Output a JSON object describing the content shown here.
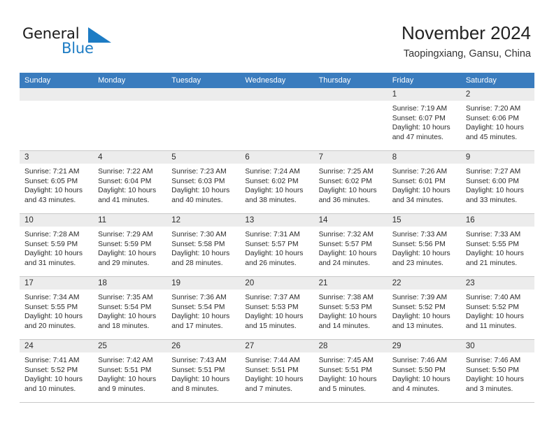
{
  "brand": {
    "name_top": "General",
    "name_bottom": "Blue",
    "mark_icon": "triangle-flag-icon",
    "accent_color": "#1d7cc4"
  },
  "header": {
    "title": "November 2024",
    "subtitle": "Taopingxiang, Gansu, China"
  },
  "calendar": {
    "header_bg": "#3a7cbe",
    "datebar_bg": "#ececec",
    "weekdays": [
      "Sunday",
      "Monday",
      "Tuesday",
      "Wednesday",
      "Thursday",
      "Friday",
      "Saturday"
    ],
    "weeks": [
      [
        {
          "day": "",
          "empty": true,
          "sunrise": "",
          "sunset": "",
          "daylight1": "",
          "daylight2": ""
        },
        {
          "day": "",
          "empty": true,
          "sunrise": "",
          "sunset": "",
          "daylight1": "",
          "daylight2": ""
        },
        {
          "day": "",
          "empty": true,
          "sunrise": "",
          "sunset": "",
          "daylight1": "",
          "daylight2": ""
        },
        {
          "day": "",
          "empty": true,
          "sunrise": "",
          "sunset": "",
          "daylight1": "",
          "daylight2": ""
        },
        {
          "day": "",
          "empty": true,
          "sunrise": "",
          "sunset": "",
          "daylight1": "",
          "daylight2": ""
        },
        {
          "day": "1",
          "empty": false,
          "sunrise": "Sunrise: 7:19 AM",
          "sunset": "Sunset: 6:07 PM",
          "daylight1": "Daylight: 10 hours",
          "daylight2": "and 47 minutes."
        },
        {
          "day": "2",
          "empty": false,
          "sunrise": "Sunrise: 7:20 AM",
          "sunset": "Sunset: 6:06 PM",
          "daylight1": "Daylight: 10 hours",
          "daylight2": "and 45 minutes."
        }
      ],
      [
        {
          "day": "3",
          "empty": false,
          "sunrise": "Sunrise: 7:21 AM",
          "sunset": "Sunset: 6:05 PM",
          "daylight1": "Daylight: 10 hours",
          "daylight2": "and 43 minutes."
        },
        {
          "day": "4",
          "empty": false,
          "sunrise": "Sunrise: 7:22 AM",
          "sunset": "Sunset: 6:04 PM",
          "daylight1": "Daylight: 10 hours",
          "daylight2": "and 41 minutes."
        },
        {
          "day": "5",
          "empty": false,
          "sunrise": "Sunrise: 7:23 AM",
          "sunset": "Sunset: 6:03 PM",
          "daylight1": "Daylight: 10 hours",
          "daylight2": "and 40 minutes."
        },
        {
          "day": "6",
          "empty": false,
          "sunrise": "Sunrise: 7:24 AM",
          "sunset": "Sunset: 6:02 PM",
          "daylight1": "Daylight: 10 hours",
          "daylight2": "and 38 minutes."
        },
        {
          "day": "7",
          "empty": false,
          "sunrise": "Sunrise: 7:25 AM",
          "sunset": "Sunset: 6:02 PM",
          "daylight1": "Daylight: 10 hours",
          "daylight2": "and 36 minutes."
        },
        {
          "day": "8",
          "empty": false,
          "sunrise": "Sunrise: 7:26 AM",
          "sunset": "Sunset: 6:01 PM",
          "daylight1": "Daylight: 10 hours",
          "daylight2": "and 34 minutes."
        },
        {
          "day": "9",
          "empty": false,
          "sunrise": "Sunrise: 7:27 AM",
          "sunset": "Sunset: 6:00 PM",
          "daylight1": "Daylight: 10 hours",
          "daylight2": "and 33 minutes."
        }
      ],
      [
        {
          "day": "10",
          "empty": false,
          "sunrise": "Sunrise: 7:28 AM",
          "sunset": "Sunset: 5:59 PM",
          "daylight1": "Daylight: 10 hours",
          "daylight2": "and 31 minutes."
        },
        {
          "day": "11",
          "empty": false,
          "sunrise": "Sunrise: 7:29 AM",
          "sunset": "Sunset: 5:59 PM",
          "daylight1": "Daylight: 10 hours",
          "daylight2": "and 29 minutes."
        },
        {
          "day": "12",
          "empty": false,
          "sunrise": "Sunrise: 7:30 AM",
          "sunset": "Sunset: 5:58 PM",
          "daylight1": "Daylight: 10 hours",
          "daylight2": "and 28 minutes."
        },
        {
          "day": "13",
          "empty": false,
          "sunrise": "Sunrise: 7:31 AM",
          "sunset": "Sunset: 5:57 PM",
          "daylight1": "Daylight: 10 hours",
          "daylight2": "and 26 minutes."
        },
        {
          "day": "14",
          "empty": false,
          "sunrise": "Sunrise: 7:32 AM",
          "sunset": "Sunset: 5:57 PM",
          "daylight1": "Daylight: 10 hours",
          "daylight2": "and 24 minutes."
        },
        {
          "day": "15",
          "empty": false,
          "sunrise": "Sunrise: 7:33 AM",
          "sunset": "Sunset: 5:56 PM",
          "daylight1": "Daylight: 10 hours",
          "daylight2": "and 23 minutes."
        },
        {
          "day": "16",
          "empty": false,
          "sunrise": "Sunrise: 7:33 AM",
          "sunset": "Sunset: 5:55 PM",
          "daylight1": "Daylight: 10 hours",
          "daylight2": "and 21 minutes."
        }
      ],
      [
        {
          "day": "17",
          "empty": false,
          "sunrise": "Sunrise: 7:34 AM",
          "sunset": "Sunset: 5:55 PM",
          "daylight1": "Daylight: 10 hours",
          "daylight2": "and 20 minutes."
        },
        {
          "day": "18",
          "empty": false,
          "sunrise": "Sunrise: 7:35 AM",
          "sunset": "Sunset: 5:54 PM",
          "daylight1": "Daylight: 10 hours",
          "daylight2": "and 18 minutes."
        },
        {
          "day": "19",
          "empty": false,
          "sunrise": "Sunrise: 7:36 AM",
          "sunset": "Sunset: 5:54 PM",
          "daylight1": "Daylight: 10 hours",
          "daylight2": "and 17 minutes."
        },
        {
          "day": "20",
          "empty": false,
          "sunrise": "Sunrise: 7:37 AM",
          "sunset": "Sunset: 5:53 PM",
          "daylight1": "Daylight: 10 hours",
          "daylight2": "and 15 minutes."
        },
        {
          "day": "21",
          "empty": false,
          "sunrise": "Sunrise: 7:38 AM",
          "sunset": "Sunset: 5:53 PM",
          "daylight1": "Daylight: 10 hours",
          "daylight2": "and 14 minutes."
        },
        {
          "day": "22",
          "empty": false,
          "sunrise": "Sunrise: 7:39 AM",
          "sunset": "Sunset: 5:52 PM",
          "daylight1": "Daylight: 10 hours",
          "daylight2": "and 13 minutes."
        },
        {
          "day": "23",
          "empty": false,
          "sunrise": "Sunrise: 7:40 AM",
          "sunset": "Sunset: 5:52 PM",
          "daylight1": "Daylight: 10 hours",
          "daylight2": "and 11 minutes."
        }
      ],
      [
        {
          "day": "24",
          "empty": false,
          "sunrise": "Sunrise: 7:41 AM",
          "sunset": "Sunset: 5:52 PM",
          "daylight1": "Daylight: 10 hours",
          "daylight2": "and 10 minutes."
        },
        {
          "day": "25",
          "empty": false,
          "sunrise": "Sunrise: 7:42 AM",
          "sunset": "Sunset: 5:51 PM",
          "daylight1": "Daylight: 10 hours",
          "daylight2": "and 9 minutes."
        },
        {
          "day": "26",
          "empty": false,
          "sunrise": "Sunrise: 7:43 AM",
          "sunset": "Sunset: 5:51 PM",
          "daylight1": "Daylight: 10 hours",
          "daylight2": "and 8 minutes."
        },
        {
          "day": "27",
          "empty": false,
          "sunrise": "Sunrise: 7:44 AM",
          "sunset": "Sunset: 5:51 PM",
          "daylight1": "Daylight: 10 hours",
          "daylight2": "and 7 minutes."
        },
        {
          "day": "28",
          "empty": false,
          "sunrise": "Sunrise: 7:45 AM",
          "sunset": "Sunset: 5:51 PM",
          "daylight1": "Daylight: 10 hours",
          "daylight2": "and 5 minutes."
        },
        {
          "day": "29",
          "empty": false,
          "sunrise": "Sunrise: 7:46 AM",
          "sunset": "Sunset: 5:50 PM",
          "daylight1": "Daylight: 10 hours",
          "daylight2": "and 4 minutes."
        },
        {
          "day": "30",
          "empty": false,
          "sunrise": "Sunrise: 7:46 AM",
          "sunset": "Sunset: 5:50 PM",
          "daylight1": "Daylight: 10 hours",
          "daylight2": "and 3 minutes."
        }
      ]
    ]
  }
}
